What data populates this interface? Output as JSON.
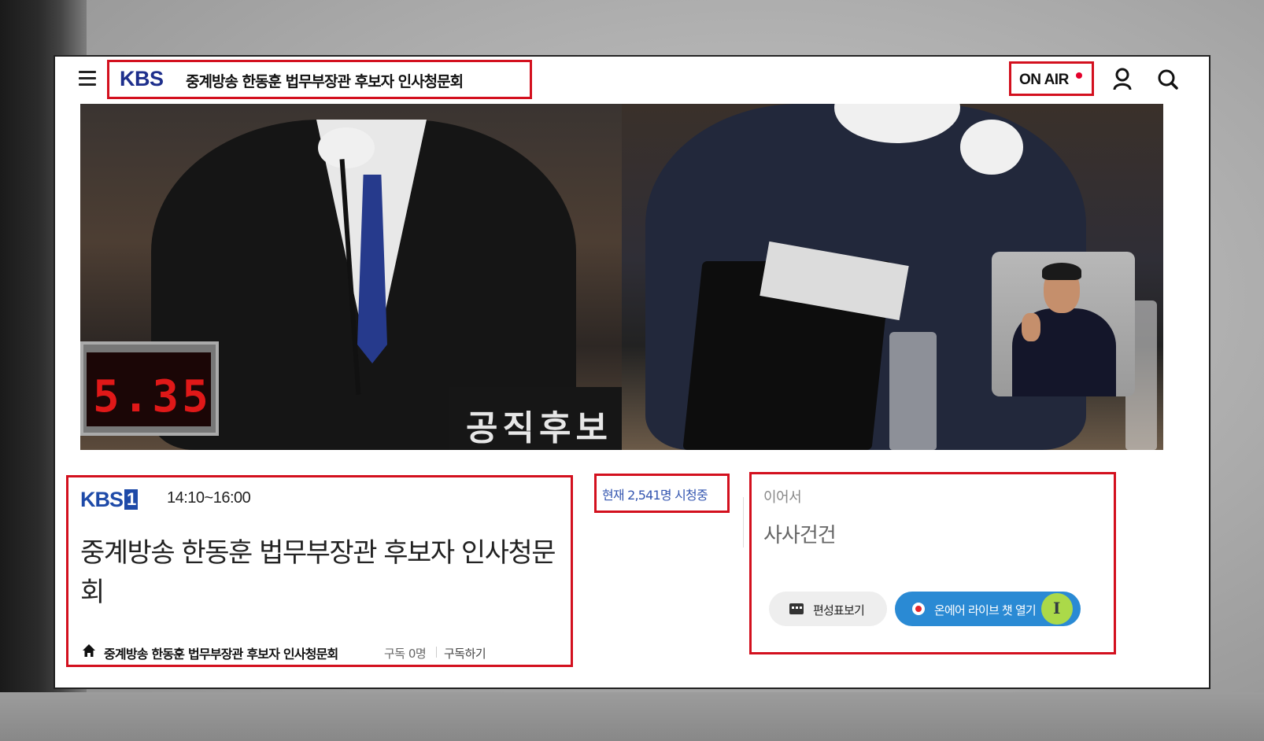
{
  "header": {
    "logo_text": "KBS",
    "title": "중계방송 한동훈 법무부장관 후보자 인사청문회",
    "onair_label": "ON AIR",
    "icons": [
      "menu-icon",
      "user-icon",
      "search-icon"
    ]
  },
  "video": {
    "clock_display": "5.35",
    "nameplate_text": "공직후보"
  },
  "program": {
    "channel_logo": "KBS",
    "channel_number": "1",
    "time": "14:10~16:00",
    "title": "중계방송 한동훈 법무부장관 후보자 인사청문회",
    "home_channel_name": "중계방송 한동훈 법무부장관 후보자 인사청문회",
    "subscribers": "구독 0명",
    "subscribe_label": "구독하기"
  },
  "viewers": {
    "text": "현재 2,541명 시청중"
  },
  "next": {
    "label": "이어서",
    "title": "사사건건",
    "schedule_button": "편성표보기",
    "chat_button": "온에어 라이브 챗 열기"
  },
  "colors": {
    "brand_blue": "#1e2f8c",
    "highlight_red": "#d3101e",
    "chat_button_blue": "#2a8ad4",
    "onair_dot": "#e4002b",
    "viewer_text": "#3456b0"
  }
}
